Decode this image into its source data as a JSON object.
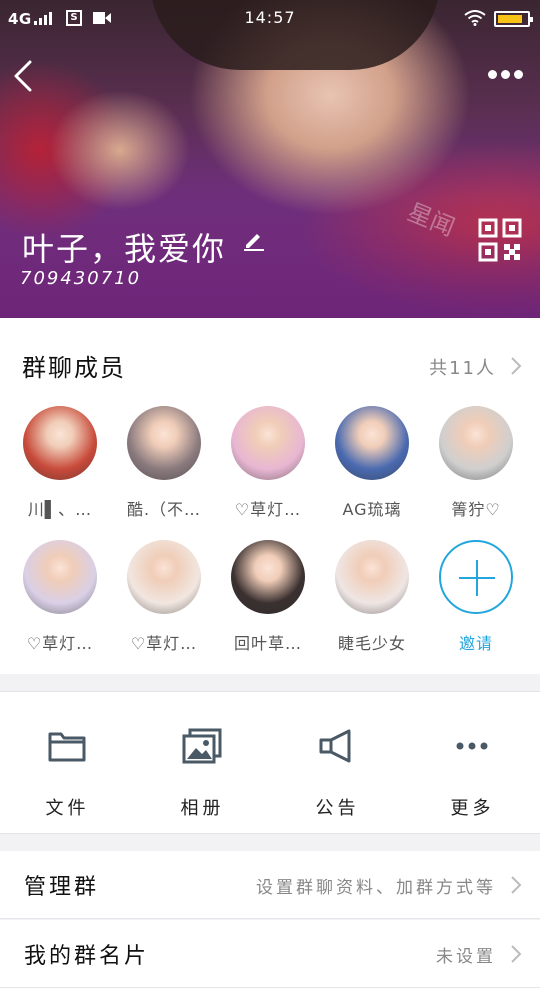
{
  "status_bar": {
    "network": "4G",
    "sim_icon": "S",
    "time": "14:57",
    "battery_level": 0.85,
    "battery_color": "#f6c316"
  },
  "header": {
    "group_name": "叶子，我爱你",
    "group_id": "709430710",
    "watermark": "星闻"
  },
  "members": {
    "title": "群聊成员",
    "count_label": "共11人",
    "list": [
      {
        "name": "川▌、…",
        "avatar": "#c84a3a"
      },
      {
        "name": "酷.（不…",
        "avatar": "#8a7a7e"
      },
      {
        "name": "♡草灯…",
        "avatar": "#e8b6d2"
      },
      {
        "name": "AG琉璃",
        "avatar": "#4a6ab0"
      },
      {
        "name": "箐狞♡",
        "avatar": "#cfcfcf"
      },
      {
        "name": "♡草灯…",
        "avatar": "#d9cfe6"
      },
      {
        "name": "♡草灯…",
        "avatar": "#f1e6e0"
      },
      {
        "name": "回叶草…",
        "avatar": "#3a3030"
      },
      {
        "name": "睫毛少女",
        "avatar": "#efe6e4"
      }
    ],
    "invite_label": "邀请",
    "accent_color": "#23a6dd"
  },
  "tools": [
    {
      "label": "文件",
      "icon": "folder-icon"
    },
    {
      "label": "相册",
      "icon": "album-icon"
    },
    {
      "label": "公告",
      "icon": "megaphone-icon"
    },
    {
      "label": "更多",
      "icon": "more-dots-icon"
    }
  ],
  "settings": {
    "manage": {
      "label": "管理群",
      "value": "设置群聊资料、加群方式等"
    },
    "card": {
      "label": "我的群名片",
      "value": "未设置"
    }
  }
}
